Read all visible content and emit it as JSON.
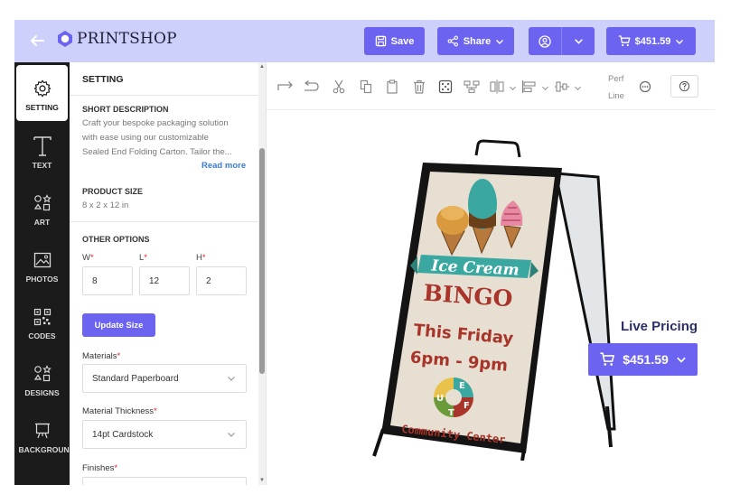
{
  "header": {
    "logo_text": "PRINTSHOP",
    "save_label": "Save",
    "share_label": "Share",
    "cart_total": "$451.59"
  },
  "rail": {
    "items": [
      {
        "label": "SETTING",
        "icon": "gear-icon"
      },
      {
        "label": "TEXT",
        "icon": "text-icon"
      },
      {
        "label": "ART",
        "icon": "shapes-icon"
      },
      {
        "label": "PHOTOS",
        "icon": "image-icon"
      },
      {
        "label": "CODES",
        "icon": "qr-code-icon"
      },
      {
        "label": "DESIGNS",
        "icon": "shapes-icon"
      },
      {
        "label": "BACKGROUND",
        "icon": "easel-icon"
      }
    ]
  },
  "panel": {
    "title": "SETTING",
    "short_description": {
      "heading": "SHORT DESCRIPTION",
      "line1": "Craft your bespoke packaging solution",
      "line2": "with ease using our customizable",
      "line3": "Sealed End Folding Carton. Tailor the...",
      "read_more": "Read more"
    },
    "product_size": {
      "heading": "PRODUCT SIZE",
      "value": "8 x 2 x 12 in"
    },
    "other_options": {
      "heading": "OTHER OPTIONS",
      "w_label": "W",
      "l_label": "L",
      "h_label": "H",
      "required_mark": "*",
      "w_value": "8",
      "l_value": "12",
      "h_value": "2"
    },
    "update_button": "Update Size",
    "materials": {
      "label": "Materials",
      "value": "Standard Paperboard"
    },
    "thickness": {
      "label": "Material Thickness",
      "value": "14pt Cardstock"
    },
    "finishes": {
      "label": "Finishes"
    }
  },
  "toolbar": {
    "perf_line1": "Perf",
    "perf_line2": "Line"
  },
  "sign": {
    "title_line1": "Ice Cream",
    "title_line2": "BINGO",
    "line3": "This Friday",
    "line4": "6pm - 9pm",
    "footer": "Community Center",
    "wheel_letters": [
      "E",
      "U",
      "F",
      "T"
    ]
  },
  "live_pricing": {
    "label": "Live Pricing",
    "price": "$451.59"
  },
  "colors": {
    "accent": "#6c63f0",
    "header_bg": "#cdd0fb",
    "rail_bg": "#1b1b1b",
    "link": "#3b7bd8",
    "required": "#e02424"
  }
}
